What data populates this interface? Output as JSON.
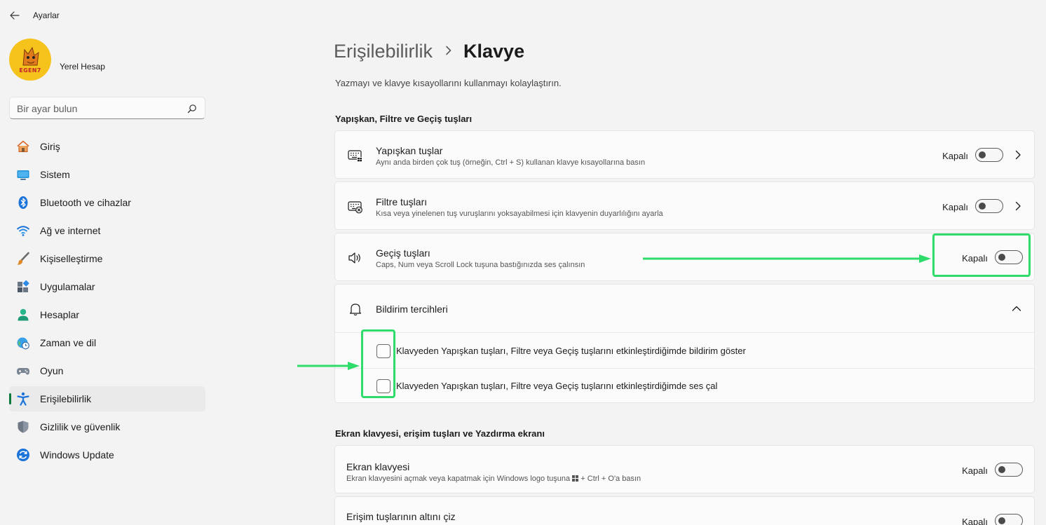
{
  "app": {
    "title": "Ayarlar"
  },
  "user": {
    "name": "Yerel Hesap",
    "avatar_text": "EGEN7"
  },
  "search": {
    "placeholder": "Bir ayar bulun"
  },
  "nav": {
    "items": [
      {
        "label": "Giriş",
        "icon": "home-icon"
      },
      {
        "label": "Sistem",
        "icon": "system-icon"
      },
      {
        "label": "Bluetooth ve cihazlar",
        "icon": "bluetooth-icon"
      },
      {
        "label": "Ağ ve internet",
        "icon": "wifi-icon"
      },
      {
        "label": "Kişiselleştirme",
        "icon": "brush-icon"
      },
      {
        "label": "Uygulamalar",
        "icon": "apps-icon"
      },
      {
        "label": "Hesaplar",
        "icon": "account-icon"
      },
      {
        "label": "Zaman ve dil",
        "icon": "clock-globe-icon"
      },
      {
        "label": "Oyun",
        "icon": "gamepad-icon"
      },
      {
        "label": "Erişilebilirlik",
        "icon": "accessibility-icon",
        "active": true
      },
      {
        "label": "Gizlilik ve güvenlik",
        "icon": "shield-icon"
      },
      {
        "label": "Windows Update",
        "icon": "update-icon"
      }
    ]
  },
  "header": {
    "parent": "Erişilebilirlik",
    "current": "Klavye"
  },
  "page_description": "Yazmayı ve klavye kısayollarını kullanmayı kolaylaştırın.",
  "sections": {
    "keys": {
      "title": "Yapışkan, Filtre ve Geçiş tuşları",
      "sticky": {
        "title": "Yapışkan tuşlar",
        "subtitle": "Aynı anda birden çok tuş (örneğin, Ctrl + S) kullanan klavye kısayollarına basın",
        "state": "Kapalı",
        "on": false
      },
      "filter": {
        "title": "Filtre tuşları",
        "subtitle": "Kısa veya yinelenen tuş vuruşlarını yoksayabilmesi için klavyenin duyarlılığını ayarla",
        "state": "Kapalı",
        "on": false
      },
      "toggle_keys": {
        "title": "Geçiş tuşları",
        "subtitle": "Caps, Num veya Scroll Lock tuşuna bastığınızda ses çalınsın",
        "state": "Kapalı",
        "on": false
      },
      "notifications": {
        "title": "Bildirim tercihleri",
        "options": [
          {
            "label": "Klavyeden Yapışkan tuşları, Filtre veya Geçiş tuşlarını etkinleştirdiğimde bildirim göster",
            "checked": false
          },
          {
            "label": "Klavyeden Yapışkan tuşları, Filtre veya Geçiş tuşlarını etkinleştirdiğimde ses çal",
            "checked": false
          }
        ]
      }
    },
    "onscreen": {
      "title": "Ekran klavyesi, erişim tuşları ve Yazdırma ekranı",
      "keyboard": {
        "title": "Ekran klavyesi",
        "subtitle_before": "Ekran klavyesini açmak veya kapatmak için Windows logo tuşuna",
        "subtitle_after": "+ Ctrl + O'a basın",
        "state": "Kapalı",
        "on": false
      },
      "underline": {
        "title": "Erişim tuşlarının altını çiz",
        "state": "Kapalı",
        "on": false
      }
    }
  },
  "colors": {
    "highlight": "#2ddc6a",
    "accent_bar": "#0a7a3c"
  }
}
